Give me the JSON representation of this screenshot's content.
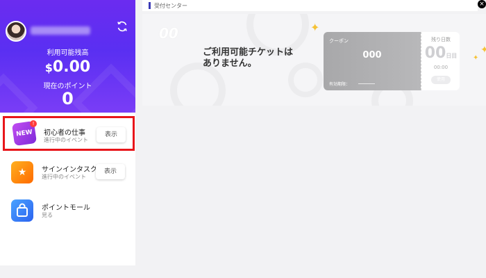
{
  "profile": {
    "balance_label": "利用可能残高",
    "balance_currency": "$",
    "balance_value": "0.00",
    "points_label": "現在のポイント",
    "points_value": "0"
  },
  "tasks": [
    {
      "title": "初心者の仕事",
      "subtitle": "進行中のイベント",
      "button": "表示",
      "icon": "new-badge-icon",
      "badge": "!"
    },
    {
      "title": "サインインタスク",
      "subtitle": "進行中のイベント",
      "button": "表示",
      "icon": "calendar-star-icon"
    },
    {
      "title": "ポイントモール",
      "subtitle": "見る",
      "icon": "shopping-bag-icon"
    }
  ],
  "header": {
    "title": "受付センター",
    "close": "×"
  },
  "banner": {
    "ghost_text": "00",
    "empty_message": "ご利用可能チケットはありません。"
  },
  "ticket": {
    "label": "クーポン",
    "value": "000",
    "expiry_label": "有効期限：",
    "days_label": "残り日数",
    "days_value": "00",
    "days_unit": "日目",
    "time": "00:00",
    "button": "使用"
  },
  "colors": {
    "profile_gradient_start": "#6b2cf0",
    "profile_gradient_end": "#7a3df6",
    "highlight_border": "#e8151a",
    "header_accent": "#3b3ab6",
    "sparkle": "#f5c236"
  }
}
